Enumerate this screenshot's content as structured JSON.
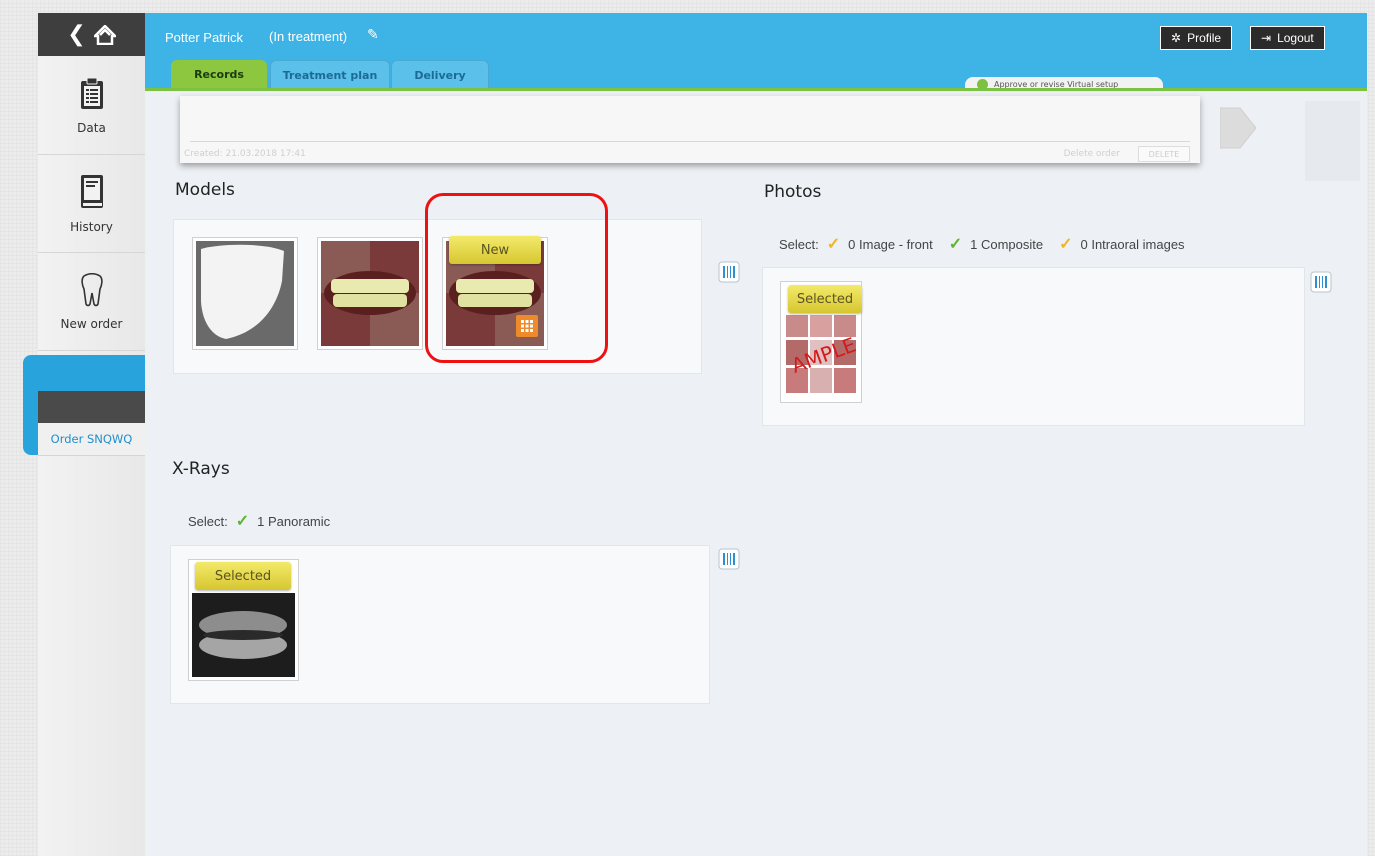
{
  "header": {
    "patient_name": "Potter Patrick",
    "status": "(In treatment)",
    "profile_label": "Profile",
    "logout_label": "Logout",
    "tabs": [
      {
        "label": "Records"
      },
      {
        "label": "Treatment plan"
      },
      {
        "label": "Delivery"
      }
    ],
    "approve_label": "Approve or revise Virtual setup"
  },
  "sidebar": {
    "items": [
      {
        "label": "Data",
        "icon": "clipboard-icon"
      },
      {
        "label": "History",
        "icon": "book-icon"
      },
      {
        "label": "New order",
        "icon": "tooth-icon"
      }
    ],
    "order_label": "Order SNQWQ"
  },
  "overlay": {
    "created": "Created: 21.03.2018 17:41",
    "delete_order": "Delete order",
    "delete_button": "DELETE"
  },
  "models": {
    "title": "Models",
    "new_badge": "New"
  },
  "photos": {
    "title": "Photos",
    "select_label": "Select:",
    "options": [
      {
        "label": "0 Image - front",
        "color": "#f0b429"
      },
      {
        "label": "1 Composite",
        "color": "#5cb531"
      },
      {
        "label": "0 Intraoral images",
        "color": "#f0b429"
      }
    ],
    "selected_badge": "Selected"
  },
  "xrays": {
    "title": "X-Rays",
    "select_label": "Select:",
    "options": [
      {
        "label": "1 Panoramic",
        "color": "#5cb531"
      }
    ],
    "selected_badge": "Selected"
  }
}
